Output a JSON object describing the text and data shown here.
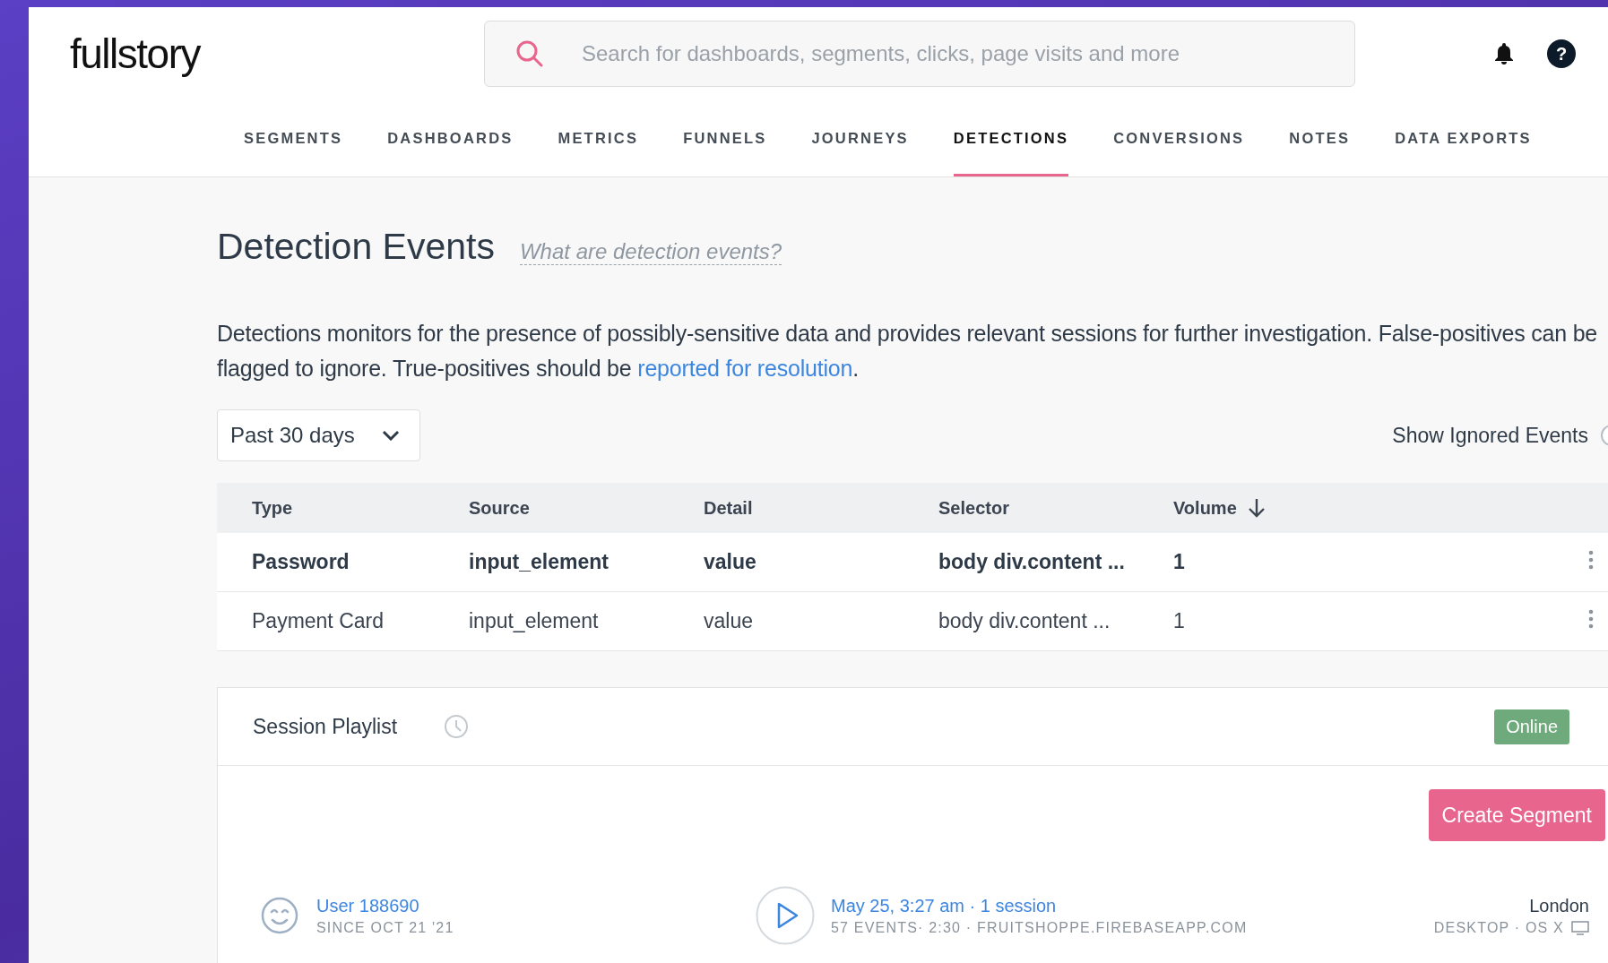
{
  "brand": "fullstory",
  "search": {
    "placeholder": "Search for dashboards, segments, clicks, page visits and more"
  },
  "nav": [
    {
      "label": "SEGMENTS",
      "selected": false
    },
    {
      "label": "DASHBOARDS",
      "selected": false
    },
    {
      "label": "METRICS",
      "selected": false
    },
    {
      "label": "FUNNELS",
      "selected": false
    },
    {
      "label": "JOURNEYS",
      "selected": false
    },
    {
      "label": "DETECTIONS",
      "selected": true
    },
    {
      "label": "CONVERSIONS",
      "selected": false
    },
    {
      "label": "NOTES",
      "selected": false
    },
    {
      "label": "DATA EXPORTS",
      "selected": false
    }
  ],
  "help_badge": "?",
  "title": "Detection Events",
  "help_link": "What are detection events?",
  "description": "Detections monitors for the presence of possibly-sensitive data and provides relevant sessions for further investigation. False-positives can be flagged to ignore. True-positives should be ",
  "description_link": "reported for resolution",
  "description_end": ".",
  "range": "Past 30 days",
  "show_ignored": {
    "label": "Show Ignored Events",
    "on": false
  },
  "table": {
    "columns": [
      "Type",
      "Source",
      "Detail",
      "Selector",
      "Volume"
    ],
    "rows": [
      {
        "cells": [
          "Password",
          "input_element",
          "value",
          "body div.content ...",
          "1"
        ],
        "unviewed": true
      },
      {
        "cells": [
          "Payment Card",
          "input_element",
          "value",
          "body div.content ...",
          "1"
        ],
        "unviewed": false
      }
    ]
  },
  "playlist": {
    "title": "Session Playlist",
    "status": "Online",
    "action": "Create Segment",
    "sessions": [
      {
        "user": "User 188690",
        "since": "SINCE OCT 21 '21",
        "when": "May 25, 3:27 am · 1 session",
        "meta": "57 EVENTS· 2:30 · FRUITSHOPPE.FIREBASEAPP.COM",
        "city": "London",
        "device": "DESKTOP · OS X"
      }
    ]
  }
}
